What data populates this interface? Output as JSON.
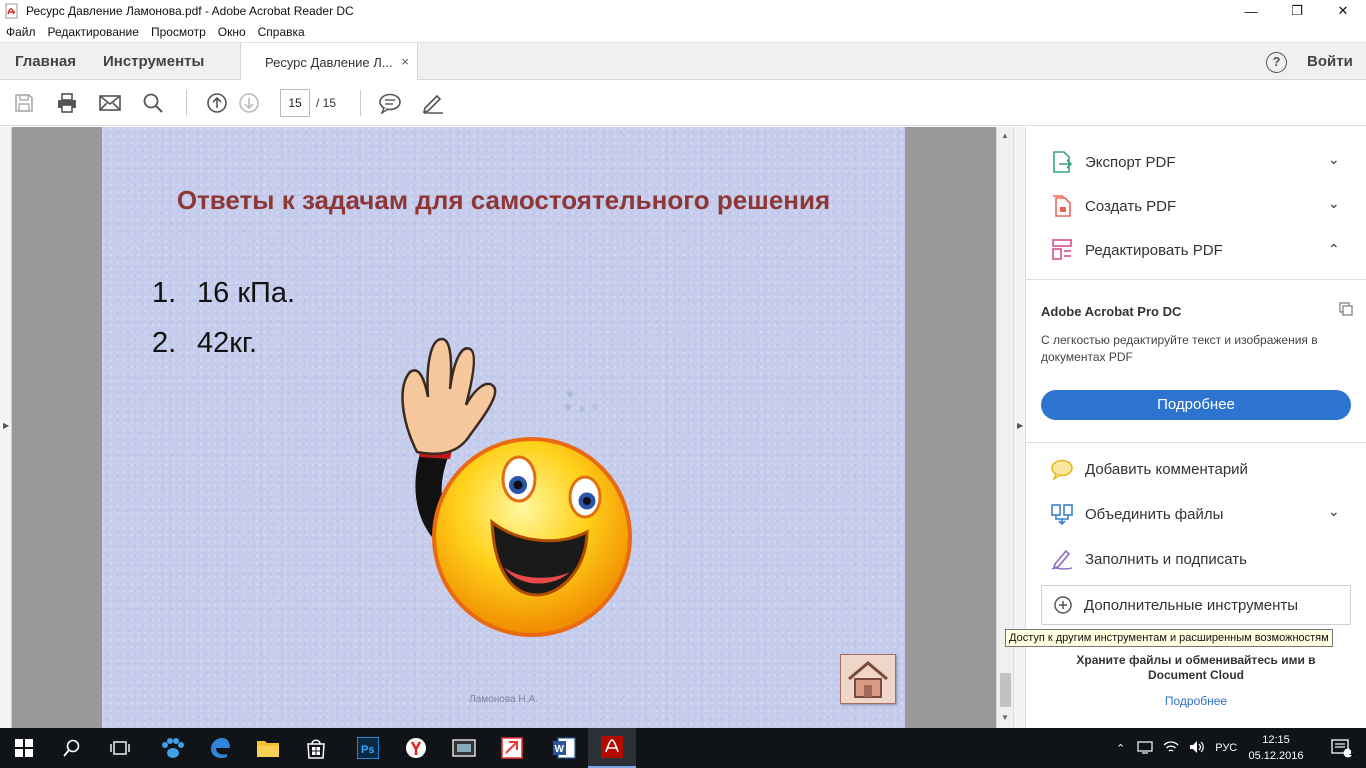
{
  "window": {
    "title": "Ресурс Давление Ламонова.pdf - Adobe Acrobat Reader DC",
    "minimize": "—",
    "maximize": "❐",
    "close": "✕"
  },
  "menu": [
    "Файл",
    "Редактирование",
    "Просмотр",
    "Окно",
    "Справка"
  ],
  "tabs": {
    "home": "Главная",
    "tools": "Инструменты",
    "document": "Ресурс Давление Л...",
    "close": "×",
    "help": "?",
    "signin": "Войти"
  },
  "toolbar": {
    "icons": [
      "save-icon",
      "print-icon",
      "mail-icon",
      "search-icon",
      "page-up-icon",
      "page-down-icon",
      "comment-icon",
      "sign-icon"
    ],
    "page_current": "15",
    "page_total": "/  15"
  },
  "document": {
    "title": "Ответы к задачам для самостоятельного решения",
    "answers": [
      {
        "num": "1.",
        "text": "16 кПа."
      },
      {
        "num": "2.",
        "text": "42кг."
      }
    ],
    "footer": "Ламонова Н.А."
  },
  "right_pane": {
    "items_top": [
      {
        "label": "Экспорт PDF",
        "icon": "export-pdf-icon",
        "chevron": "⌄"
      },
      {
        "label": "Создать PDF",
        "icon": "create-pdf-icon",
        "chevron": "⌄"
      },
      {
        "label": "Редактировать PDF",
        "icon": "edit-pdf-icon",
        "chevron": "⌃"
      }
    ],
    "pro": {
      "title": "Adobe Acrobat Pro DC",
      "description": "С легкостью редактируйте текст и изображения в документах PDF",
      "button": "Подробнее"
    },
    "items_bottom": [
      {
        "label": "Добавить комментарий",
        "icon": "comment-icon"
      },
      {
        "label": "Объединить файлы",
        "icon": "combine-files-icon",
        "chevron": "⌄"
      },
      {
        "label": "Заполнить и подписать",
        "icon": "fill-sign-icon"
      }
    ],
    "more_tools": "Дополнительные инструменты",
    "cloud_text_1": "Храните файлы и обменивайтесь ими в",
    "cloud_text_2": "Document Cloud",
    "cloud_link": "Подробнее"
  },
  "tooltip": "Доступ к другим инструментам и расширенным возможностям",
  "taskbar": {
    "apps": [
      "windows-start-icon",
      "search-icon",
      "task-view-icon",
      "paw-icon",
      "edge-icon",
      "explorer-icon",
      "store-icon",
      "photoshop-icon",
      "yandex-icon",
      "media-icon",
      "acrobat-pro-icon",
      "word-icon",
      "acrobat-reader-icon"
    ],
    "language": "РУС",
    "time": "12:15",
    "date": "05.12.2016",
    "notifications": "1",
    "colors": {
      "accent": "#7aa7e0",
      "background": "#101419"
    }
  },
  "colors": {
    "title_red": "#8e3737",
    "button_blue": "#2d74d0",
    "link_blue": "#2d6ec6"
  }
}
